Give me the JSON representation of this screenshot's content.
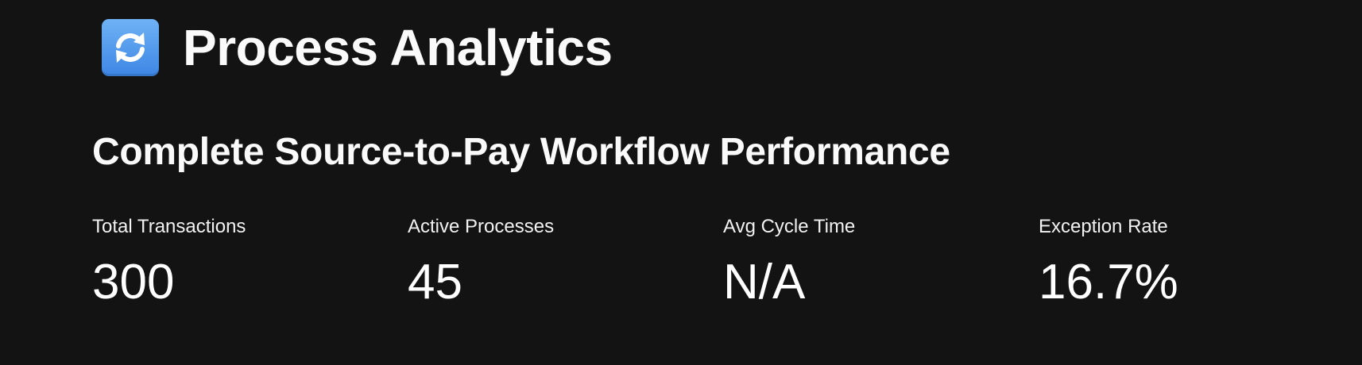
{
  "header": {
    "icon": "refresh-arrows-icon",
    "icon_color": "#4f95ec",
    "title": "Process Analytics"
  },
  "subtitle": "Complete Source-to-Pay Workflow Performance",
  "metrics": [
    {
      "label": "Total Transactions",
      "value": "300"
    },
    {
      "label": "Active Processes",
      "value": "45"
    },
    {
      "label": "Avg Cycle Time",
      "value": "N/A"
    },
    {
      "label": "Exception Rate",
      "value": "16.7%"
    }
  ],
  "theme": {
    "background": "#131313",
    "text": "#fafafa"
  }
}
